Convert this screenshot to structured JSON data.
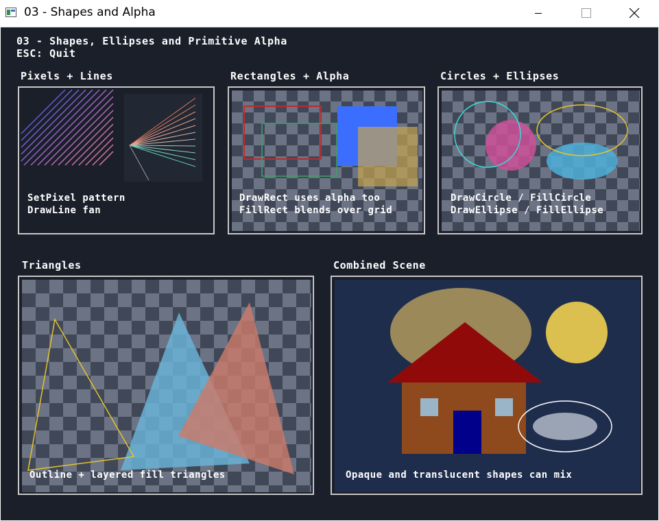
{
  "window": {
    "title": "03 - Shapes and Alpha",
    "icon": "app-window-icon",
    "controls": [
      "minimize-icon",
      "maximize-icon",
      "close-icon"
    ]
  },
  "header": {
    "title": "03 - Shapes, Ellipses and Primitive Alpha",
    "hint": "ESC: Quit"
  },
  "panels": {
    "pixels_lines": {
      "title": "Pixels + Lines",
      "line1": "SetPixel pattern",
      "line2": "DrawLine fan"
    },
    "rectangles": {
      "title": "Rectangles + Alpha",
      "line1": "DrawRect uses alpha too",
      "line2": "FillRect blends over grid"
    },
    "circles": {
      "title": "Circles + Ellipses",
      "line1": "DrawCircle / FillCircle",
      "line2": "DrawEllipse / FillEllipse"
    },
    "triangles": {
      "title": "Triangles",
      "caption": "Outline + layered fill triangles"
    },
    "combined": {
      "title": "Combined Scene",
      "caption": "Opaque and translucent shapes can mix"
    }
  },
  "colors": {
    "background": "#1b1f2a",
    "panel_border": "#c8c8c8",
    "checker_light": "#6b7384",
    "checker_dark": "#404858",
    "scene_background": "#1f2d4d"
  }
}
